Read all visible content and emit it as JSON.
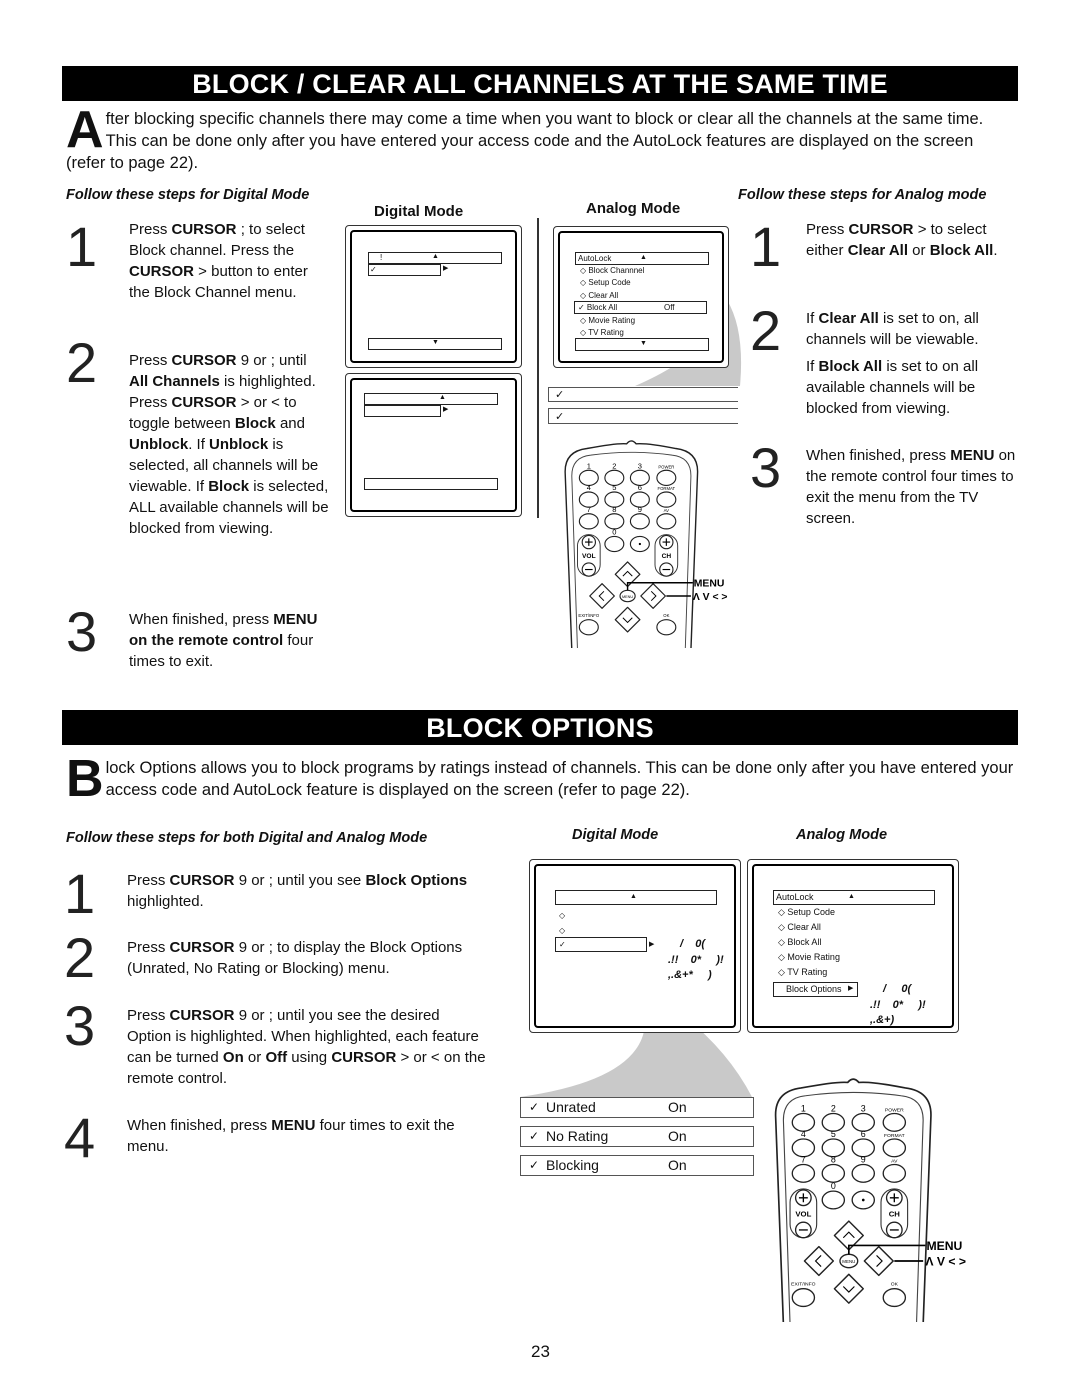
{
  "section1": {
    "title": "BLOCK / CLEAR ALL CHANNELS AT THE SAME TIME",
    "intro_drop": "A",
    "intro": "fter blocking specific channels there may come a time when you want to block or clear all the channels at the same time.  This can be done only after you have entered your access code and the AutoLock features are displayed on the screen (refer to page 22).",
    "digital_heading": "Follow these steps for Digital Mode",
    "analog_heading": "Follow these steps for Analog mode",
    "digital_steps": [
      {
        "num": "1",
        "segments": [
          {
            "t": "Press "
          },
          {
            "t": "CURSOR",
            "b": true
          },
          {
            "t": " ;   to select Block channel. Press the "
          },
          {
            "t": "CURSOR",
            "b": true
          },
          {
            "t": "  >  button to enter the Block Channel menu."
          }
        ]
      },
      {
        "num": "2",
        "segments": [
          {
            "t": "Press "
          },
          {
            "t": "CURSOR",
            "b": true
          },
          {
            "t": " 9   or ;  until "
          },
          {
            "t": "All Channels",
            "b": true
          },
          {
            "t": " is highlighted.  Press "
          },
          {
            "t": "CURSOR",
            "b": true
          },
          {
            "t": " > or < to toggle between "
          },
          {
            "t": "Block",
            "b": true
          },
          {
            "t": " and "
          },
          {
            "t": "Unblock",
            "b": true
          },
          {
            "t": ".  If "
          },
          {
            "t": "Unblock",
            "b": true
          },
          {
            "t": " is selected, all channels will be viewable.  If "
          },
          {
            "t": "Block",
            "b": true
          },
          {
            "t": " is selected,  ALL available channels will be blocked from viewing."
          }
        ]
      },
      {
        "num": "3",
        "segments": [
          {
            "t": "When finished, press "
          },
          {
            "t": "MENU on the remote control",
            "b": true
          },
          {
            "t": " four times to exit."
          }
        ]
      }
    ],
    "analog_steps": [
      {
        "num": "1",
        "segments": [
          {
            "t": "Press "
          },
          {
            "t": "CURSOR",
            "b": true
          },
          {
            "t": "  > to select either "
          },
          {
            "t": "Clear All",
            "b": true
          },
          {
            "t": " or "
          },
          {
            "t": "Block All",
            "b": true
          },
          {
            "t": "."
          }
        ]
      },
      {
        "num": "2",
        "segments": [
          {
            "t": "If "
          },
          {
            "t": "Clear All",
            "b": true
          },
          {
            "t": " is set to on, all channels will be viewable."
          }
        ]
      },
      {
        "num": "",
        "segments": [
          {
            "t": " If "
          },
          {
            "t": "Block All",
            "b": true
          },
          {
            "t": " is set to on all available channels will be blocked from viewing."
          }
        ]
      },
      {
        "num": "3",
        "segments": [
          {
            "t": "When finished, press "
          },
          {
            "t": "MENU",
            "b": true
          },
          {
            "t": " on the remote control four times to exit the menu from the TV screen."
          }
        ]
      }
    ],
    "digital_mode_label": "Digital Mode",
    "analog_mode_label": "Analog Mode",
    "digital_screen1": {
      "row1_glyph": "!",
      "row2_check": "✓"
    },
    "analog_screen": {
      "header": "AutoLock",
      "items": [
        "◇ Block Channnel",
        "◇ Setup Code",
        "◇ Clear All",
        "✓ Block All",
        "◇ Movie Rating",
        "◇ TV Rating"
      ],
      "selected_value": "Off"
    },
    "check_rows": [
      "✓",
      "✓"
    ]
  },
  "section2": {
    "title": "BLOCK OPTIONS",
    "intro_drop": "B",
    "intro": "lock Options allows you to block programs by ratings instead of channels.   This can be done only after you have entered your access code and AutoLock feature is displayed on the screen (refer to page 22).",
    "heading": "Follow these steps for both Digital and Analog Mode",
    "steps": [
      {
        "num": "1",
        "segments": [
          {
            "t": "Press "
          },
          {
            "t": "CURSOR",
            "b": true
          },
          {
            "t": " 9   or ;   until you see "
          },
          {
            "t": "Block Options",
            "b": true
          },
          {
            "t": " highlighted."
          }
        ]
      },
      {
        "num": "2",
        "segments": [
          {
            "t": "Press "
          },
          {
            "t": "CURSOR",
            "b": true
          },
          {
            "t": " 9   or ;   to display the Block Options (Unrated, No Rating or Blocking) menu."
          }
        ]
      },
      {
        "num": "3",
        "segments": [
          {
            "t": "Press "
          },
          {
            "t": "CURSOR",
            "b": true
          },
          {
            "t": " 9   or ;   until you see the desired Option is highlighted.  When highlighted, each feature can be turned "
          },
          {
            "t": "On",
            "b": true
          },
          {
            "t": " or "
          },
          {
            "t": "Off",
            "b": true
          },
          {
            "t": " using "
          },
          {
            "t": "CURSOR",
            "b": true
          },
          {
            "t": " >  or < on the remote control."
          }
        ]
      },
      {
        "num": "4",
        "segments": [
          {
            "t": "When finished, press "
          },
          {
            "t": "MENU",
            "b": true
          },
          {
            "t": " four times to exit the menu."
          }
        ]
      }
    ],
    "digital_mode_label": "Digital Mode",
    "analog_mode_label": "Analog Mode",
    "digital_screen": {
      "items": [
        "◇",
        "◇",
        "✓"
      ],
      "garble": [
        "/    0(",
        ".!!    0*     )!",
        ",.&+*     )"
      ]
    },
    "analog_screen": {
      "header": "AutoLock",
      "items": [
        "◇ Setup Code",
        "◇ Clear All",
        "◇ Block All",
        "◇ Movie Rating",
        "◇ TV Rating"
      ],
      "selected": "Block Options",
      "garble": [
        "/     0(",
        ".!!    0*     )!",
        ",.&+)"
      ]
    },
    "options": [
      {
        "check": "✓",
        "label": "Unrated",
        "value": "On"
      },
      {
        "check": "✓",
        "label": "No Rating",
        "value": "On"
      },
      {
        "check": "✓",
        "label": "Blocking",
        "value": "On"
      }
    ]
  },
  "remote": {
    "digits": [
      "1",
      "2",
      "3",
      "4",
      "5",
      "6",
      "7",
      "8",
      "9",
      "0"
    ],
    "power": "POWER",
    "format": "FORMAT",
    "av": "AV",
    "vol": "VOL",
    "ch": "CH",
    "menu": "MENU",
    "exit": "EXIT/INFO",
    "ok": "OK",
    "callout_menu": "MENU",
    "callout_arrows": "Λ  V  <  >"
  },
  "page_number": "23",
  "colors": {
    "bar": "#000000",
    "swoosh": "#c9c9c9"
  }
}
